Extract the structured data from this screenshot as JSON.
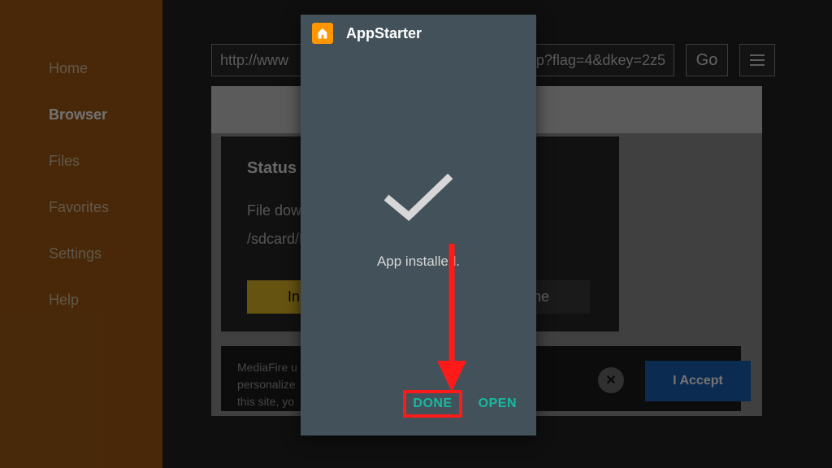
{
  "sidebar": {
    "items": [
      {
        "label": "Home"
      },
      {
        "label": "Browser"
      },
      {
        "label": "Files"
      },
      {
        "label": "Favorites"
      },
      {
        "label": "Settings"
      },
      {
        "label": "Help"
      }
    ],
    "active_index": 1
  },
  "urlbar": {
    "prefix": "http://www",
    "suffix": "p?flag=4&dkey=2z5",
    "go_label": "Go"
  },
  "status_card": {
    "title": "Status",
    "line1": "File downl",
    "line2": "/sdcard/D",
    "install_label": "Insta",
    "done_label": "Done"
  },
  "cookie": {
    "line1": "MediaFire u",
    "line2": "personalize",
    "line3": "this site, yo",
    "accept_label": "I Accept",
    "close_glyph": "✕"
  },
  "modal": {
    "title": "AppStarter",
    "message": "App installed.",
    "done_label": "DONE",
    "open_label": "OPEN"
  }
}
